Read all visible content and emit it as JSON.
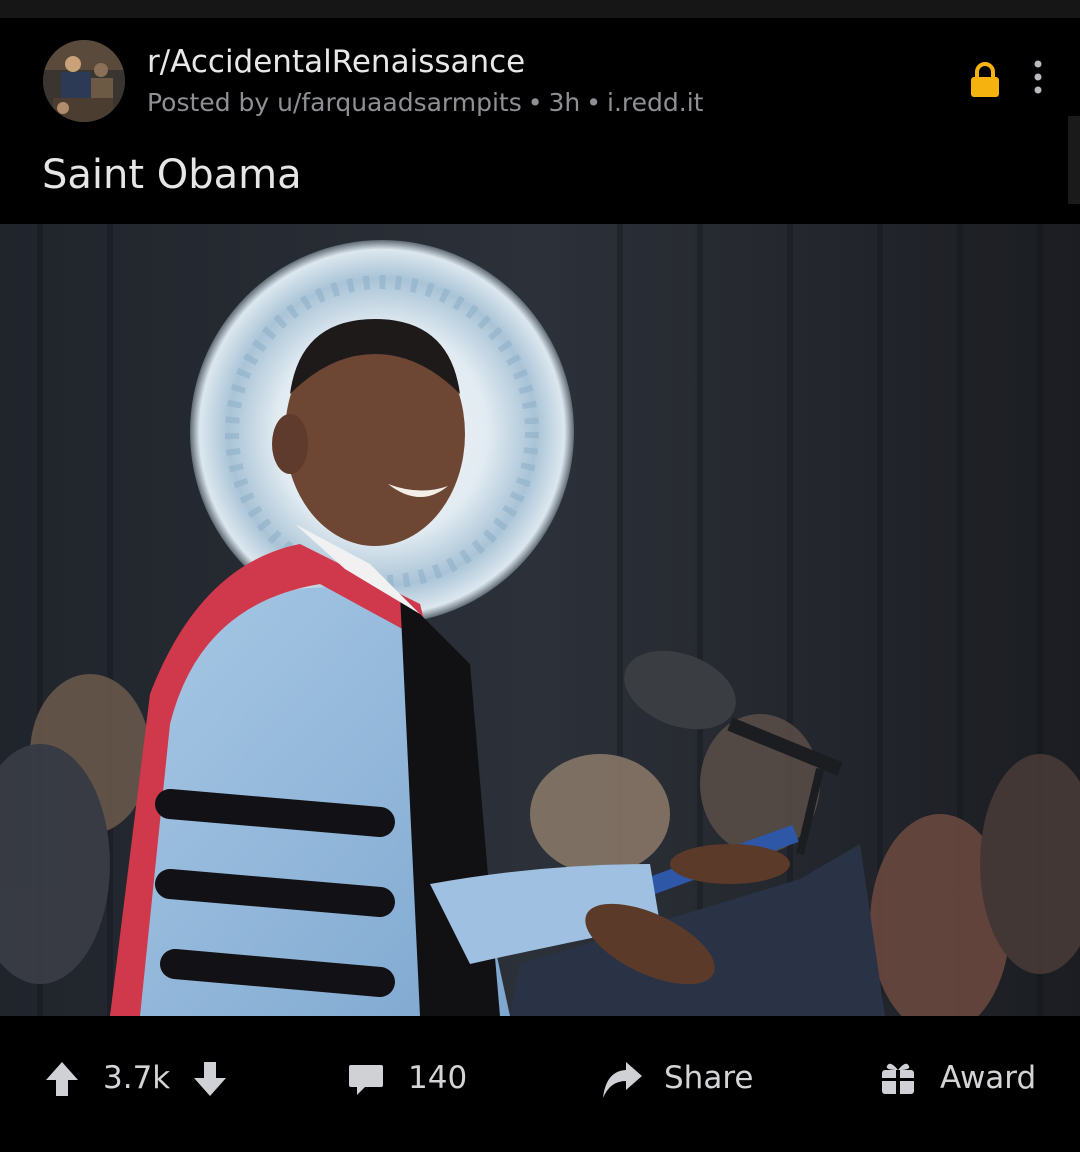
{
  "post": {
    "subreddit": "r/AccidentalRenaissance",
    "posted_by": "Posted by u/farquaadsarmpits",
    "age": "3h",
    "domain": "i.redd.it",
    "separator": "•",
    "title": "Saint Obama",
    "locked": true
  },
  "actions": {
    "score": "3.7k",
    "comments": "140",
    "share_label": "Share",
    "award_label": "Award"
  },
  "icons": {
    "avatar": "subreddit-avatar",
    "lock": "lock-icon",
    "more": "more-vertical-icon",
    "upvote": "upvote-arrow-icon",
    "downvote": "downvote-arrow-icon",
    "comment": "comment-bubble-icon",
    "share": "share-arrow-icon",
    "award": "gift-award-icon"
  },
  "colors": {
    "background": "#000000",
    "lock": "#f6b20e",
    "text_primary": "#e8e8e8",
    "text_secondary": "#8e9093"
  }
}
